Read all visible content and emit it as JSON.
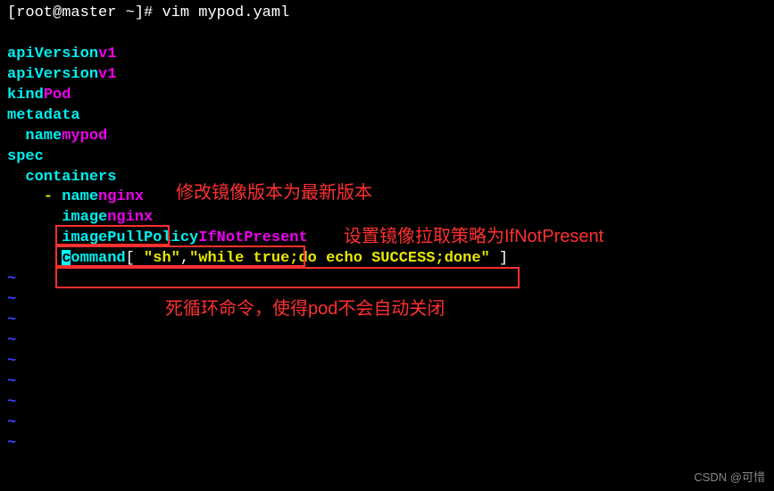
{
  "prompt": {
    "text": "[root@master ~]# ",
    "command": "vim mypod.yaml"
  },
  "yaml": {
    "apiVersion_key": "apiVersion",
    "apiVersion_val": "v1",
    "apiVersion2_key": "apiVersion",
    "apiVersion2_val": "v1",
    "kind_key": "kind",
    "kind_val": "Pod",
    "metadata_key": "metadata",
    "name_key": "name",
    "name_val": "mypod",
    "spec_key": "spec",
    "containers_key": "containers",
    "dash": "- ",
    "cname_key": "name",
    "cname_val": "nginx",
    "image_key": "image",
    "image_val": "nginx",
    "ipp_key": "imagePullPolicy",
    "ipp_val": "IfNotPresent",
    "cmd_key": "ommand",
    "cmd_bracket_open": "[ ",
    "cmd_arg1": "\"sh\"",
    "cmd_comma": ",",
    "cmd_arg2": "\"while true;do echo SUCCESS;done\"",
    "cmd_bracket_close": " ]"
  },
  "tilde": "~",
  "cursor_char": "c",
  "colon": ":",
  "space": " ",
  "annotations": {
    "a1": "修改镜像版本为最新版本",
    "a2": "设置镜像拉取策略为IfNotPresent",
    "a3": "死循环命令，使得pod不会自动关闭"
  },
  "watermark": "CSDN @可惜"
}
